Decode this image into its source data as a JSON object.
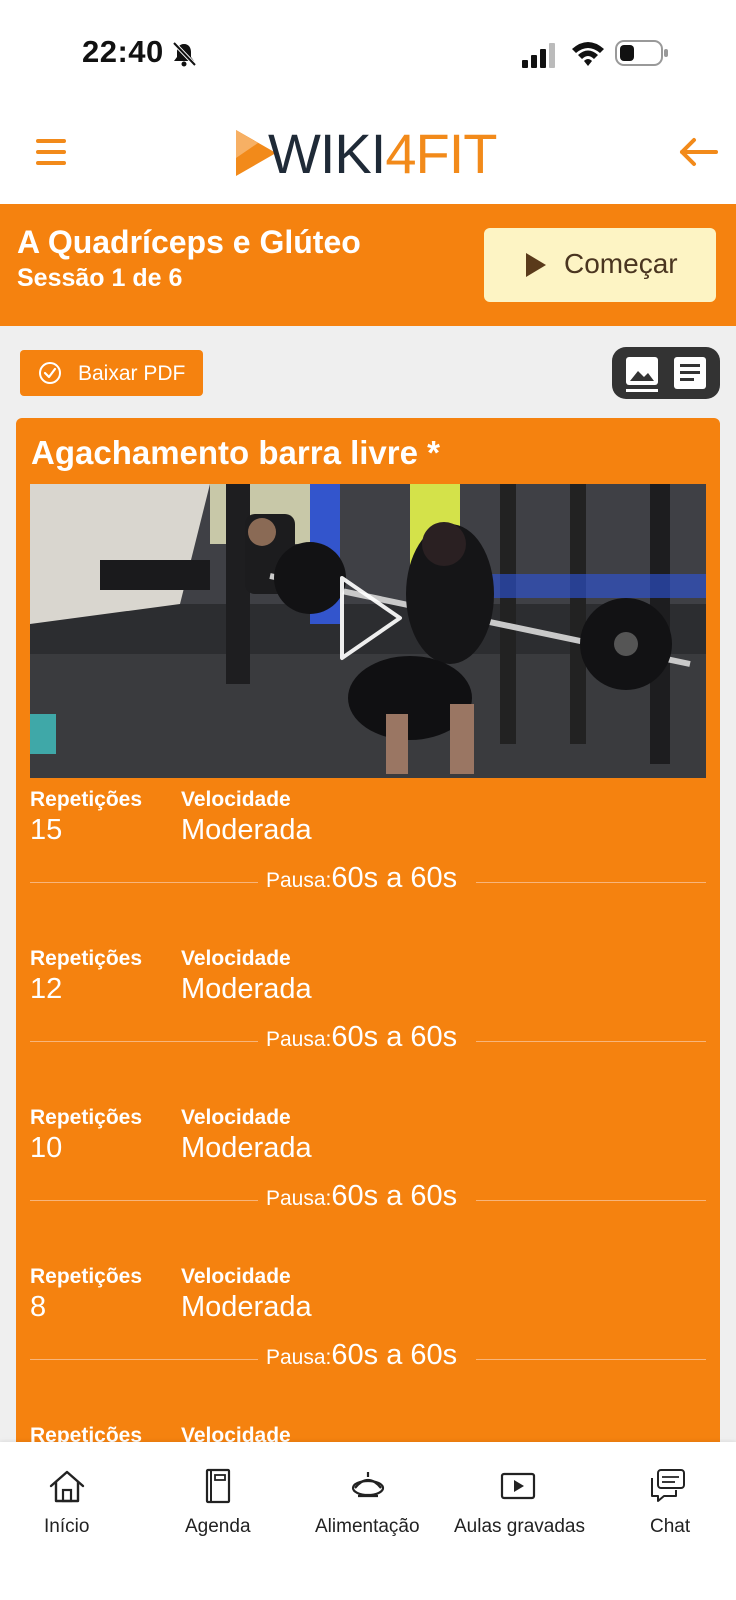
{
  "status_bar": {
    "time": "22:40"
  },
  "header": {
    "logo_part1": "WIKI",
    "logo_part2": "4",
    "logo_part3": "FIT"
  },
  "banner": {
    "title": "A Quadríceps e Glúteo",
    "subtitle": "Sessão 1 de 6",
    "start_label": "Começar"
  },
  "toolbar": {
    "pdf_label": "Baixar PDF"
  },
  "exercise": {
    "title": "Agachamento barra livre *",
    "rep_label": "Repetições",
    "speed_label": "Velocidade",
    "pause_label": "Pausa:",
    "sets": [
      {
        "reps": "15",
        "speed": "Moderada",
        "pause": "60s a 60s"
      },
      {
        "reps": "12",
        "speed": "Moderada",
        "pause": "60s a 60s"
      },
      {
        "reps": "10",
        "speed": "Moderada",
        "pause": "60s a 60s"
      },
      {
        "reps": "8",
        "speed": "Moderada",
        "pause": "60s a 60s"
      },
      {
        "reps": "",
        "speed": "",
        "pause": ""
      }
    ]
  },
  "bottom_nav": {
    "items": [
      {
        "label": "Início",
        "icon": "home-icon"
      },
      {
        "label": "Agenda",
        "icon": "notebook-icon"
      },
      {
        "label": "Alimentação",
        "icon": "food-icon"
      },
      {
        "label": "Aulas gravadas",
        "icon": "video-icon"
      },
      {
        "label": "Chat",
        "icon": "chat-icon"
      }
    ]
  },
  "colors": {
    "brand_orange": "#f5820f",
    "start_button_bg": "#fdf4c4",
    "logo_dark": "#1f2a37"
  }
}
